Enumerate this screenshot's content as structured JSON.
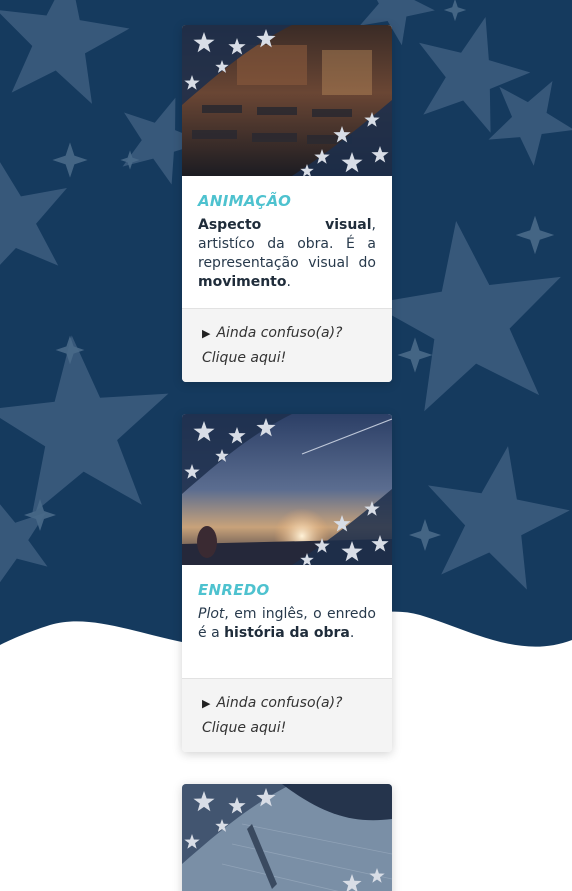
{
  "colors": {
    "navy_background": "#153a5e",
    "star_color": "#3f5f80",
    "title_accent": "#4ec2cf",
    "body_text": "#283a4c",
    "footer_bg": "#f4f4f4"
  },
  "cards": [
    {
      "title": "ANIMAÇÃO",
      "text": {
        "bold1": "Aspecto visual",
        "plain1": ", artistíco da obra. É a representação visual do ",
        "bold2": "movimento",
        "plain2": "."
      },
      "footer": {
        "arrow": "▶",
        "line1": "Ainda confuso(a)?",
        "line2": "Clique aqui!"
      },
      "image_icon": "classroom-night-image"
    },
    {
      "title": "ENREDO",
      "text": {
        "italic1": "Plot",
        "plain1": ", em inglês, o enredo é a ",
        "bold1": "história da obra",
        "plain2": "."
      },
      "footer": {
        "arrow": "▶",
        "line1": "Ainda confuso(a)?",
        "line2": "Clique aqui!"
      },
      "image_icon": "sunset-sky-image"
    },
    {
      "image_icon": "sketch-drawing-image"
    }
  ]
}
